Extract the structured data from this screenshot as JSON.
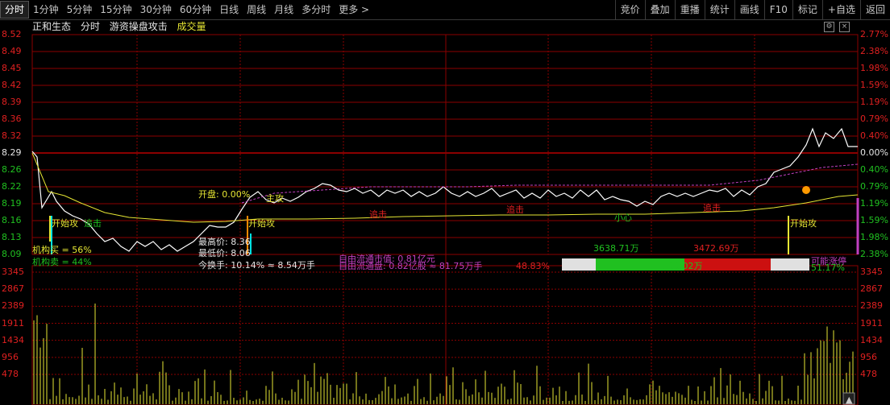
{
  "tabs": [
    {
      "label": "分时",
      "active": true
    },
    {
      "label": "1分钟"
    },
    {
      "label": "5分钟"
    },
    {
      "label": "15分钟"
    },
    {
      "label": "30分钟"
    },
    {
      "label": "60分钟"
    },
    {
      "label": "日线"
    },
    {
      "label": "周线"
    },
    {
      "label": "月线"
    },
    {
      "label": "多分时"
    },
    {
      "label": "更多 >"
    }
  ],
  "tools": [
    "竞价",
    "叠加",
    "重播",
    "统计",
    "画线",
    "F10",
    "标记",
    "+自选",
    "返回"
  ],
  "title": {
    "stock": "正和生态",
    "mode": "分时",
    "indicator": "游资操盘攻击",
    "volume": "成交量"
  },
  "price_axis": {
    "left": [
      "8.52",
      "8.49",
      "8.45",
      "8.42",
      "8.39",
      "8.36",
      "8.32",
      "8.29",
      "8.26",
      "8.22",
      "8.19",
      "8.16",
      "8.13",
      "8.09"
    ],
    "right": [
      "2.77%",
      "2.38%",
      "1.98%",
      "1.59%",
      "1.19%",
      "0.79%",
      "0.40%",
      "0.00%",
      "0.40%",
      "0.79%",
      "1.19%",
      "1.59%",
      "1.98%",
      "2.38%"
    ]
  },
  "volume_axis": [
    "3345",
    "2867",
    "2389",
    "1911",
    "1434",
    "956",
    "478"
  ],
  "annotations": {
    "open": "开盘: 0.00%",
    "high": "最高价: 8.36",
    "low": "最低价: 8.06",
    "turnover": "今换手: 10.14% ≈ 8.54万手",
    "inst_buy": "机构买 = 56%",
    "inst_sell": "机构卖 = 44%",
    "main_attack": "主攻",
    "chase1": "追击",
    "chase2": "追击",
    "chase3": "追击",
    "careful": "小心",
    "start_attack1": "开始攻",
    "start_attack2": "开始攻",
    "start_attack3": "开始攻",
    "drop_ovl": "追击",
    "free_cap": "自由流通市值: 0.81亿元",
    "free_float": "自由流通盘: 0.82亿股 ≈ 81.75万手",
    "ratio": "48.83%",
    "buy_amt": "3638.71万",
    "sell_amt": "3472.69万",
    "net": "-166.02万",
    "right_tag": "可能涨停",
    "right_pct": "51.17%"
  },
  "colors": {
    "up": "#e02020",
    "down": "#20c020",
    "price": "#ffffff",
    "avg": "#e6e633",
    "ma": "#c040c0",
    "grid": "#8b0000"
  },
  "chart_data": {
    "type": "line",
    "price_range": [
      8.09,
      8.52
    ],
    "base_price": 8.29,
    "volume_max": 3345
  }
}
